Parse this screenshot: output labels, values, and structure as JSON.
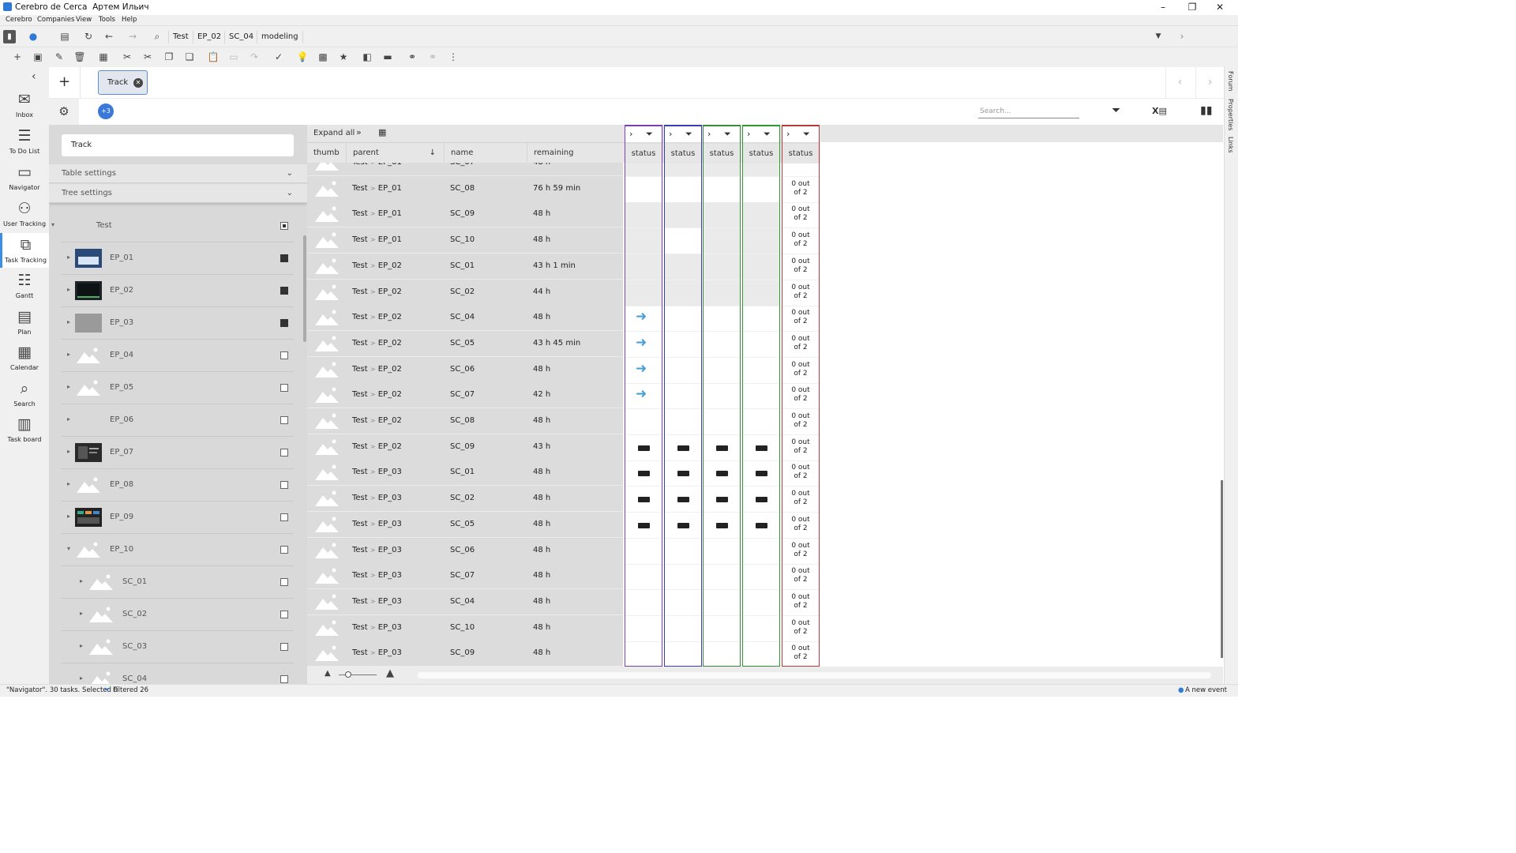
{
  "window": {
    "app_title": "Cerebro de Cerca",
    "user": "Артем Ильич",
    "controls": [
      "–",
      "❐",
      "✕"
    ]
  },
  "menu": [
    "Cerebro",
    "Companies",
    "View",
    "Tools",
    "Help"
  ],
  "breadcrumb": [
    "Test",
    "EP_02",
    "SC_04",
    "modeling"
  ],
  "nav": [
    {
      "label": "Inbox",
      "icon": "envelope-icon",
      "glyph": "✉",
      "active": false
    },
    {
      "label": "To Do List",
      "icon": "todo-list-icon",
      "glyph": "☰",
      "active": false
    },
    {
      "label": "Navigator",
      "icon": "folder-icon",
      "glyph": "▭",
      "active": false
    },
    {
      "label": "User Tracking",
      "icon": "users-icon",
      "glyph": "⚇",
      "active": false
    },
    {
      "label": "Task Tracking",
      "icon": "flow-icon",
      "glyph": "⧉",
      "active": true
    },
    {
      "label": "Gantt",
      "icon": "gantt-icon",
      "glyph": "☷",
      "active": false
    },
    {
      "label": "Plan",
      "icon": "plan-icon",
      "glyph": "▤",
      "active": false
    },
    {
      "label": "Calendar",
      "icon": "calendar-icon",
      "glyph": "▦",
      "active": false
    },
    {
      "label": "Search",
      "icon": "search-icon",
      "glyph": "⌕",
      "active": false
    },
    {
      "label": "Task board",
      "icon": "taskboard-icon",
      "glyph": "▥",
      "active": false
    }
  ],
  "tab": {
    "label": "Track"
  },
  "counter_badge": "+3",
  "search": {
    "placeholder": "Search..."
  },
  "left": {
    "filter_value": "Track",
    "table_settings": "Table settings",
    "tree_settings": "Tree settings",
    "tree": [
      {
        "name": "Test",
        "level": 0,
        "thumb": "none",
        "check": "dot",
        "arrow": "▾"
      },
      {
        "name": "EP_01",
        "level": 1,
        "thumb": "blue",
        "check": "on",
        "arrow": "▸"
      },
      {
        "name": "EP_02",
        "level": 1,
        "thumb": "dark",
        "check": "on",
        "arrow": "▸"
      },
      {
        "name": "EP_03",
        "level": 1,
        "thumb": "grey",
        "check": "on",
        "arrow": "▸"
      },
      {
        "name": "EP_04",
        "level": 1,
        "thumb": "mountain",
        "check": "off",
        "arrow": "▸"
      },
      {
        "name": "EP_05",
        "level": 1,
        "thumb": "mountain",
        "check": "off",
        "arrow": "▸"
      },
      {
        "name": "EP_06",
        "level": 1,
        "thumb": "none",
        "check": "off",
        "arrow": "▸"
      },
      {
        "name": "EP_07",
        "level": 1,
        "thumb": "screen",
        "check": "off",
        "arrow": "▸"
      },
      {
        "name": "EP_08",
        "level": 1,
        "thumb": "mountain",
        "check": "off",
        "arrow": "▸"
      },
      {
        "name": "EP_09",
        "level": 1,
        "thumb": "colorful",
        "check": "off",
        "arrow": "▸"
      },
      {
        "name": "EP_10",
        "level": 1,
        "thumb": "mountain",
        "check": "off",
        "arrow": "▾"
      },
      {
        "name": "SC_01",
        "level": 2,
        "thumb": "mountain",
        "check": "off",
        "arrow": "▸"
      },
      {
        "name": "SC_02",
        "level": 2,
        "thumb": "mountain",
        "check": "off",
        "arrow": "▸"
      },
      {
        "name": "SC_03",
        "level": 2,
        "thumb": "mountain",
        "check": "off",
        "arrow": "▸"
      },
      {
        "name": "SC_04",
        "level": 2,
        "thumb": "mountain",
        "check": "off",
        "arrow": "▸"
      }
    ]
  },
  "grid": {
    "expand_all": "Expand all",
    "columns": [
      "thumb",
      "parent",
      "name",
      "remaining"
    ],
    "status_label": "status",
    "status_border_colors": [
      "#7b3fb0",
      "#3b3bb8",
      "#3b8a3b",
      "#2e9a2e",
      "#b83b3b"
    ],
    "rows": [
      {
        "parent": [
          "Test",
          "EP_01"
        ],
        "name": "SC_07",
        "remaining": "48 h",
        "status": [
          "g",
          "g",
          "g",
          "g",
          "of 2"
        ]
      },
      {
        "parent": [
          "Test",
          "EP_01"
        ],
        "name": "SC_08",
        "remaining": "76 h 59 min",
        "status": [
          "",
          "",
          "",
          "",
          "0 out of 2"
        ]
      },
      {
        "parent": [
          "Test",
          "EP_01"
        ],
        "name": "SC_09",
        "remaining": "48 h",
        "status": [
          "g",
          "g",
          "g",
          "g",
          "0 out of 2"
        ]
      },
      {
        "parent": [
          "Test",
          "EP_01"
        ],
        "name": "SC_10",
        "remaining": "48 h",
        "status": [
          "g",
          "",
          "g",
          "g",
          "0 out of 2"
        ]
      },
      {
        "parent": [
          "Test",
          "EP_02"
        ],
        "name": "SC_01",
        "remaining": "43 h 1 min",
        "status": [
          "g",
          "g",
          "g",
          "g",
          "0 out of 2"
        ]
      },
      {
        "parent": [
          "Test",
          "EP_02"
        ],
        "name": "SC_02",
        "remaining": "44 h",
        "status": [
          "g",
          "g",
          "g",
          "g",
          "0 out of 2"
        ]
      },
      {
        "parent": [
          "Test",
          "EP_02"
        ],
        "name": "SC_04",
        "remaining": "48 h",
        "status": [
          "arrow",
          "",
          "",
          "",
          "0 out of 2"
        ]
      },
      {
        "parent": [
          "Test",
          "EP_02"
        ],
        "name": "SC_05",
        "remaining": "43 h 45 min",
        "status": [
          "arrow",
          "",
          "",
          "",
          "0 out of 2"
        ]
      },
      {
        "parent": [
          "Test",
          "EP_02"
        ],
        "name": "SC_06",
        "remaining": "48 h",
        "status": [
          "arrow",
          "",
          "",
          "",
          "0 out of 2"
        ]
      },
      {
        "parent": [
          "Test",
          "EP_02"
        ],
        "name": "SC_07",
        "remaining": "42 h",
        "status": [
          "arrow",
          "",
          "",
          "",
          "0 out of 2"
        ]
      },
      {
        "parent": [
          "Test",
          "EP_02"
        ],
        "name": "SC_08",
        "remaining": "48 h",
        "status": [
          "",
          "",
          "",
          "",
          "0 out of 2"
        ]
      },
      {
        "parent": [
          "Test",
          "EP_02"
        ],
        "name": "SC_09",
        "remaining": "43 h",
        "status": [
          "block",
          "block",
          "block",
          "block",
          "0 out of 2"
        ]
      },
      {
        "parent": [
          "Test",
          "EP_03"
        ],
        "name": "SC_01",
        "remaining": "48 h",
        "status": [
          "block",
          "block",
          "block",
          "block",
          "0 out of 2"
        ]
      },
      {
        "parent": [
          "Test",
          "EP_03"
        ],
        "name": "SC_02",
        "remaining": "48 h",
        "status": [
          "block",
          "block",
          "block",
          "block",
          "0 out of 2"
        ]
      },
      {
        "parent": [
          "Test",
          "EP_03"
        ],
        "name": "SC_05",
        "remaining": "48 h",
        "status": [
          "block",
          "block",
          "block",
          "block",
          "0 out of 2"
        ]
      },
      {
        "parent": [
          "Test",
          "EP_03"
        ],
        "name": "SC_06",
        "remaining": "48 h",
        "status": [
          "",
          "",
          "",
          "",
          "0 out of 2"
        ]
      },
      {
        "parent": [
          "Test",
          "EP_03"
        ],
        "name": "SC_07",
        "remaining": "48 h",
        "status": [
          "",
          "",
          "",
          "",
          "0 out of 2"
        ]
      },
      {
        "parent": [
          "Test",
          "EP_03"
        ],
        "name": "SC_04",
        "remaining": "48 h",
        "status": [
          "",
          "",
          "",
          "",
          "0 out of 2"
        ]
      },
      {
        "parent": [
          "Test",
          "EP_03"
        ],
        "name": "SC_10",
        "remaining": "48 h",
        "status": [
          "",
          "",
          "",
          "",
          "0 out of 2"
        ]
      },
      {
        "parent": [
          "Test",
          "EP_03"
        ],
        "name": "SC_09",
        "remaining": "48 h",
        "status": [
          "",
          "",
          "",
          "",
          "0 out of 2"
        ]
      }
    ]
  },
  "right_strip": [
    "Forum",
    "Properties",
    "Links"
  ],
  "status_bar": {
    "left": "\"Navigator\". 30 tasks. Selected 0",
    "filtered": "Filtered 26",
    "right": "A new event"
  }
}
